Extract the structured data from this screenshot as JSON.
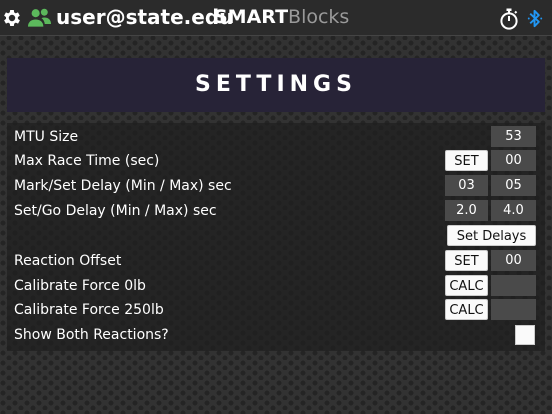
{
  "header": {
    "user_email": "user@state.edu",
    "logo_bold": "SMART",
    "logo_light": "Blocks",
    "accent_color": "#5cb85c",
    "bluetooth_color": "#2196f3"
  },
  "page_title": "SETTINGS",
  "settings": {
    "mtu_size": {
      "label": "MTU Size",
      "value": "53"
    },
    "max_race_time": {
      "label": "Max Race Time (sec)",
      "button": "SET",
      "value": "00"
    },
    "mark_set_delay": {
      "label": "Mark/Set Delay (Min / Max) sec",
      "min": "03",
      "max": "05"
    },
    "set_go_delay": {
      "label": "Set/Go Delay (Min / Max) sec",
      "min": "2.0",
      "max": "4.0"
    },
    "set_delays_button": "Set Delays",
    "reaction_offset": {
      "label": "Reaction Offset",
      "button": "SET",
      "value": "00"
    },
    "calibrate_0": {
      "label": "Calibrate Force 0lb",
      "button": "CALC",
      "value": ""
    },
    "calibrate_250": {
      "label": "Calibrate Force 250lb",
      "button": "CALC",
      "value": ""
    },
    "show_both": {
      "label": "Show Both Reactions?",
      "checked": false
    }
  }
}
